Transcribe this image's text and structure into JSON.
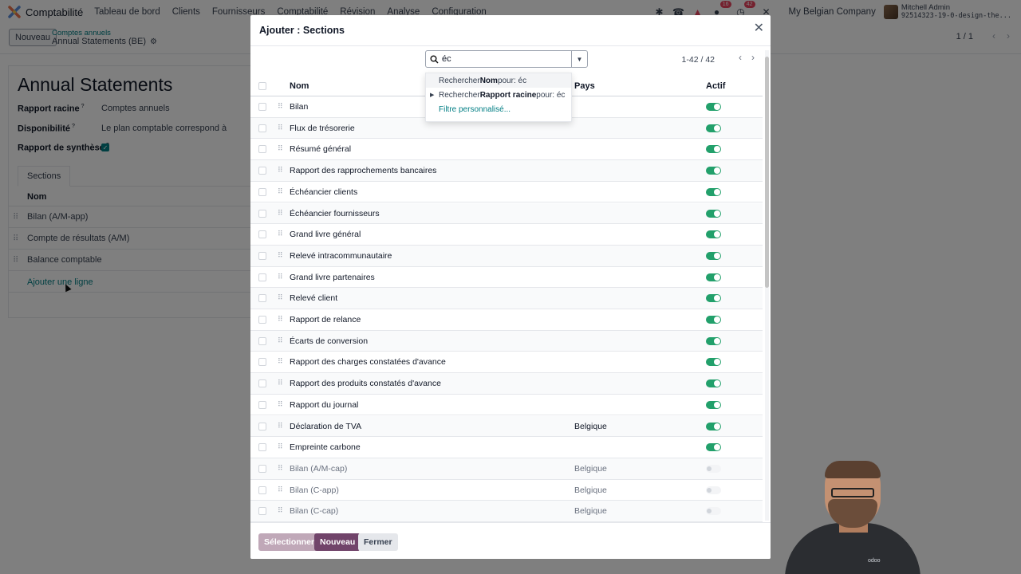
{
  "navbar": {
    "app_name": "Comptabilité",
    "menu": [
      "Tableau de bord",
      "Clients",
      "Fournisseurs",
      "Comptabilité",
      "Révision",
      "Analyse",
      "Configuration"
    ],
    "messages_badge": "16",
    "activities_badge": "42",
    "company": "My Belgian Company",
    "user_name": "Mitchell Admin",
    "database": "92514323-19-0-design-the..."
  },
  "control_panel": {
    "new_button": "Nouveau",
    "breadcrumb_parent": "Comptes annuels",
    "breadcrumb_current": "Annual Statements (BE)",
    "pager": "1 / 1"
  },
  "form": {
    "title": "Annual Statements",
    "fields": [
      {
        "label": "Rapport racine",
        "help": "?",
        "value": "Comptes annuels"
      },
      {
        "label": "Disponibilité",
        "help": "?",
        "value": "Le plan comptable correspond à"
      },
      {
        "label": "Rapport de synthèse",
        "help": "?",
        "value": ""
      }
    ],
    "tab": "Sections",
    "column": "Nom",
    "rows": [
      "Bilan (A/M-app)",
      "Compte de résultats (A/M)",
      "Balance comptable"
    ],
    "add_line": "Ajouter une ligne"
  },
  "modal": {
    "title": "Ajouter : Sections",
    "search": {
      "value": "éc",
      "options": [
        {
          "prefix": "Rechercher ",
          "field": "Nom",
          "suffix": " pour: éc"
        },
        {
          "prefix": "Rechercher ",
          "field": "Rapport racine",
          "suffix": " pour: éc"
        }
      ],
      "custom_filter": "Filtre personnalisé..."
    },
    "pager": "1-42 / 42",
    "columns": {
      "name": "Nom",
      "country": "Pays",
      "active": "Actif"
    },
    "rows": [
      {
        "name": "Bilan",
        "country": "",
        "active": true
      },
      {
        "name": "Flux de trésorerie",
        "country": "",
        "active": true
      },
      {
        "name": "Résumé général",
        "country": "",
        "active": true
      },
      {
        "name": "Rapport des rapprochements bancaires",
        "country": "",
        "active": true
      },
      {
        "name": "Échéancier clients",
        "country": "",
        "active": true
      },
      {
        "name": "Échéancier fournisseurs",
        "country": "",
        "active": true
      },
      {
        "name": "Grand livre général",
        "country": "",
        "active": true
      },
      {
        "name": "Relevé intracommunautaire",
        "country": "",
        "active": true
      },
      {
        "name": "Grand livre partenaires",
        "country": "",
        "active": true
      },
      {
        "name": "Relevé client",
        "country": "",
        "active": true
      },
      {
        "name": "Rapport de relance",
        "country": "",
        "active": true
      },
      {
        "name": "Écarts de conversion",
        "country": "",
        "active": true
      },
      {
        "name": "Rapport des charges constatées d'avance",
        "country": "",
        "active": true
      },
      {
        "name": "Rapport des produits constatés d'avance",
        "country": "",
        "active": true
      },
      {
        "name": "Rapport du journal",
        "country": "",
        "active": true
      },
      {
        "name": "Déclaration de TVA",
        "country": "Belgique",
        "active": true
      },
      {
        "name": "Empreinte carbone",
        "country": "",
        "active": true
      },
      {
        "name": "Bilan (A/M-cap)",
        "country": "Belgique",
        "active": false
      },
      {
        "name": "Bilan (C-app)",
        "country": "Belgique",
        "active": false
      },
      {
        "name": "Bilan (C-cap)",
        "country": "Belgique",
        "active": false
      }
    ],
    "buttons": {
      "select": "Sélectionner",
      "new": "Nouveau",
      "close": "Fermer"
    }
  },
  "webcam": {
    "shirt_logo": "odoo"
  }
}
